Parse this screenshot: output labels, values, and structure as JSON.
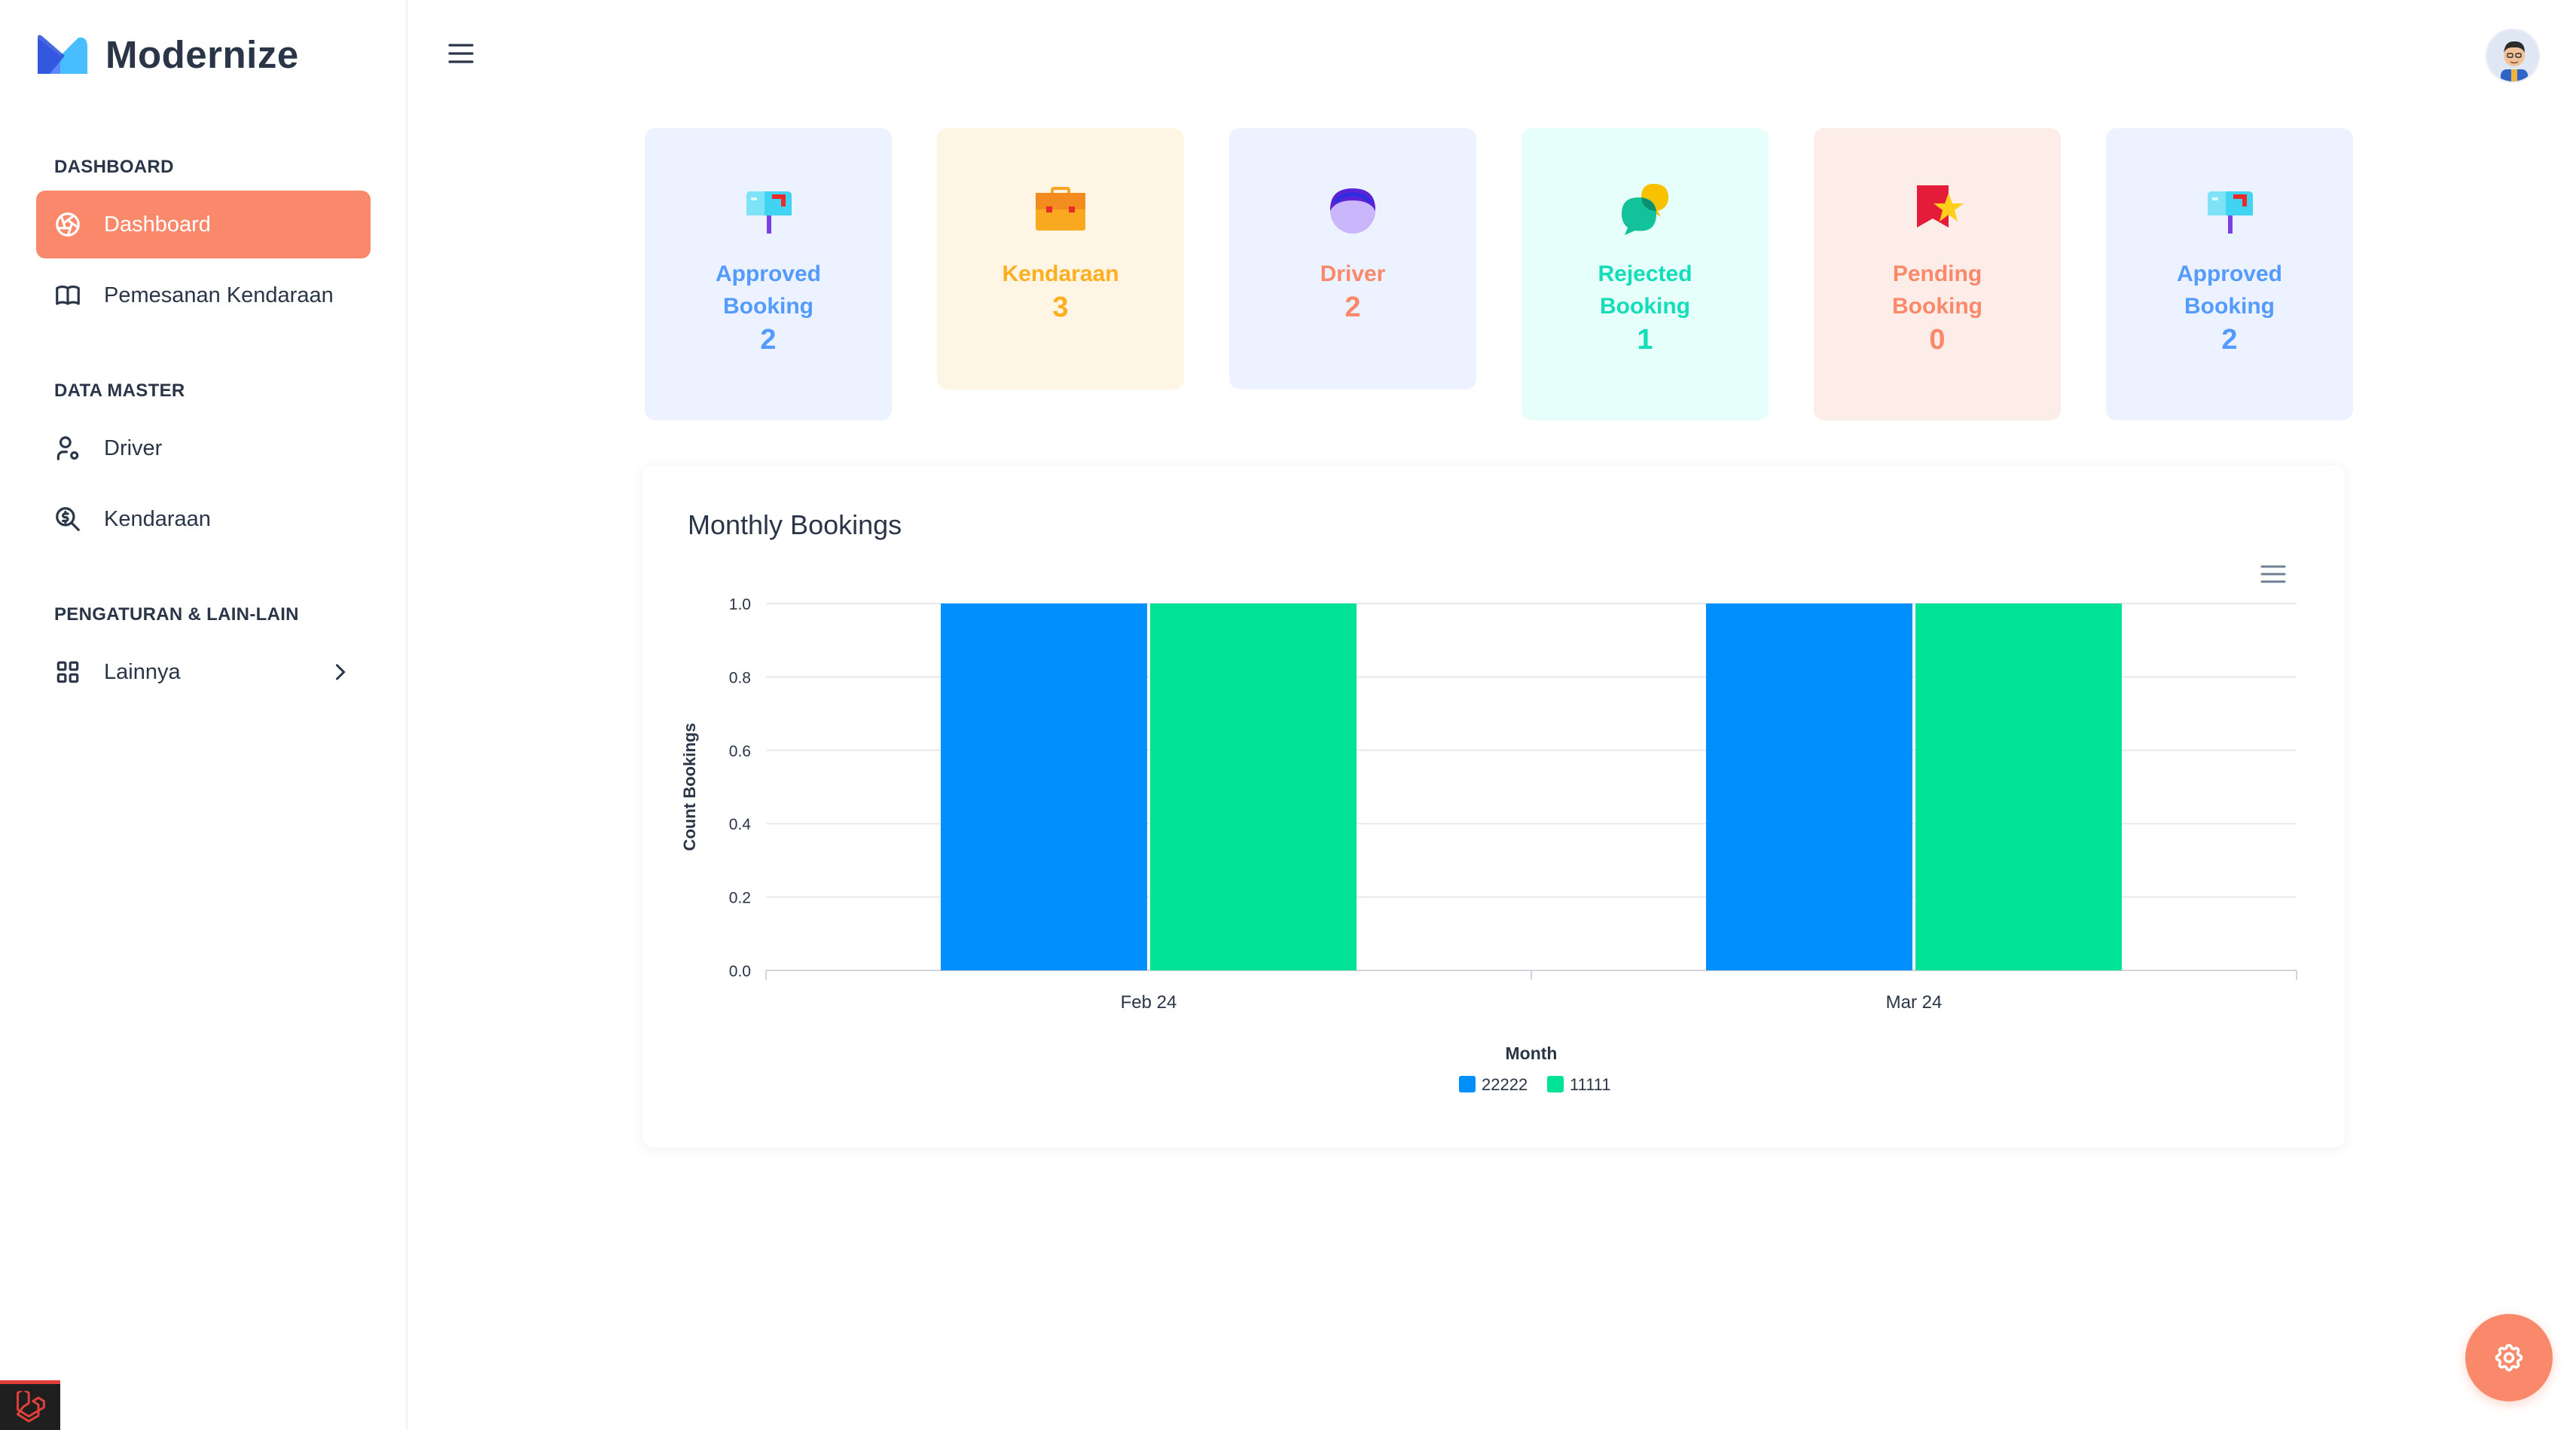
{
  "brand": {
    "name": "Modernize"
  },
  "sidebar": {
    "sections": [
      {
        "title": "DASHBOARD"
      },
      {
        "title": "DATA MASTER"
      },
      {
        "title": "PENGATURAN & LAIN-LAIN"
      }
    ],
    "items": [
      {
        "label": "Dashboard",
        "icon": "aperture-icon",
        "active": true
      },
      {
        "label": "Pemesanan Kendaraan",
        "icon": "book-icon"
      },
      {
        "label": "Driver",
        "icon": "user-icon"
      },
      {
        "label": "Kendaraan",
        "icon": "search-dollar-icon"
      },
      {
        "label": "Lainnya",
        "icon": "grid-icon"
      }
    ]
  },
  "cards": [
    {
      "label": "Approved Booking",
      "value": "2",
      "icon": "mailbox-icon",
      "color": "#539bff",
      "bg": "#ecf2ff"
    },
    {
      "label": "Kendaraan",
      "value": "3",
      "icon": "briefcase-icon",
      "color": "#ffae1f",
      "bg": "#fef5e5"
    },
    {
      "label": "Driver",
      "value": "2",
      "icon": "user-avatar-icon",
      "color": "#fa896b",
      "bg": "#ecf2ff"
    },
    {
      "label": "Rejected Booking",
      "value": "1",
      "icon": "chat-bubbles-icon",
      "color": "#13deb9",
      "bg": "#e6fffa"
    },
    {
      "label": "Pending Booking",
      "value": "0",
      "icon": "flag-star-icon",
      "color": "#fa896b",
      "bg": "#fdede8"
    },
    {
      "label": "Approved Booking",
      "value": "2",
      "icon": "mailbox-icon",
      "color": "#539bff",
      "bg": "#ecf2ff"
    }
  ],
  "chart": {
    "title": "Monthly Bookings"
  },
  "chart_data": {
    "type": "bar",
    "categories": [
      "Feb 24",
      "Mar 24"
    ],
    "series": [
      {
        "name": "22222",
        "values": [
          1,
          1
        ],
        "color": "#008ffb"
      },
      {
        "name": "11111",
        "values": [
          1,
          1
        ],
        "color": "#00e396"
      }
    ],
    "xlabel": "Month",
    "ylabel": "Count Bookings",
    "ylim": [
      0,
      1
    ],
    "yticks": [
      "0.0",
      "0.2",
      "0.4",
      "0.6",
      "0.8",
      "1.0"
    ],
    "grid": true,
    "legend": "bottom"
  }
}
